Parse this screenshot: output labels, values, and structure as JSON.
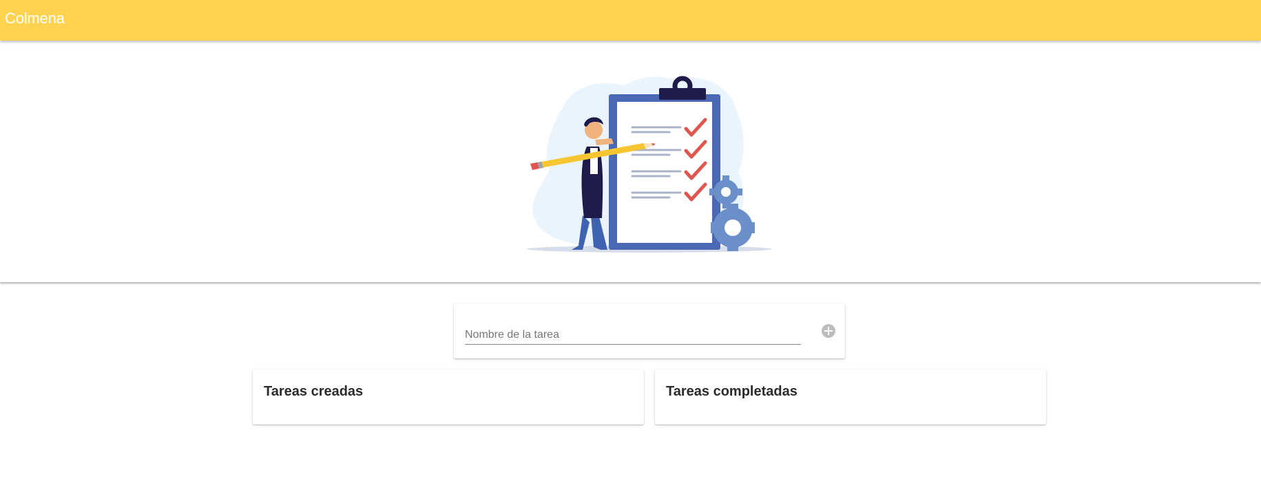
{
  "app": {
    "title": "Colmena"
  },
  "hero": {
    "illustration": "task-checklist-illustration"
  },
  "task_form": {
    "input_placeholder": "Nombre de la tarea",
    "input_value": "",
    "add_icon": "add-circle-icon"
  },
  "lists": {
    "created_title": "Tareas creadas",
    "completed_title": "Tareas completadas"
  },
  "colors": {
    "topbar": "#FFD250",
    "title_text": "#FFFFFF",
    "card_background": "#FFFFFF",
    "add_icon": "#BDBDBD",
    "clipboard_frame": "#4A68B3",
    "checkmark": "#E0564F",
    "pencil": "#F7C52F"
  }
}
